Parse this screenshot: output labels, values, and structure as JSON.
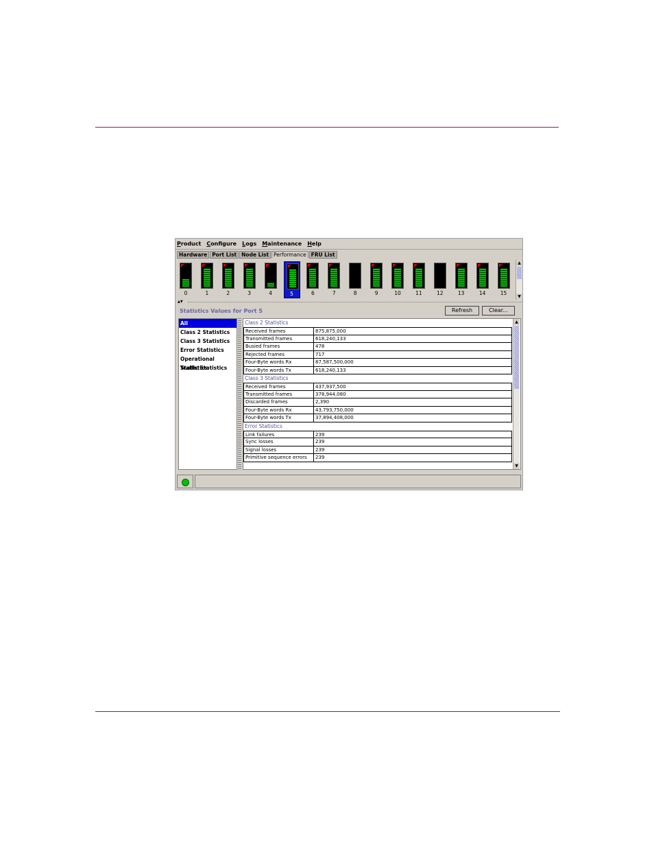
{
  "window": {
    "menus": [
      {
        "label": "Product",
        "underline": "P",
        "rest": "roduct"
      },
      {
        "label": "Configure",
        "underline": "C",
        "rest": "onfigure"
      },
      {
        "label": "Logs",
        "underline": "L",
        "rest": "ogs"
      },
      {
        "label": "Maintenance",
        "underline": "M",
        "rest": "aintenance"
      },
      {
        "label": "Help",
        "underline": "H",
        "rest": "elp"
      }
    ],
    "tabs": [
      {
        "label": "Hardware",
        "active": false
      },
      {
        "label": "Port List",
        "active": false
      },
      {
        "label": "Node List",
        "active": false
      },
      {
        "label": "Performance",
        "active": true
      },
      {
        "label": "FRU List",
        "active": false
      }
    ]
  },
  "ports": [
    {
      "num": "0",
      "level": 0.35,
      "flag": true
    },
    {
      "num": "1",
      "level": 0.85,
      "flag": true
    },
    {
      "num": "2",
      "level": 0.85,
      "flag": true
    },
    {
      "num": "3",
      "level": 0.85,
      "flag": true
    },
    {
      "num": "4",
      "level": 0.2,
      "flag": true
    },
    {
      "num": "5",
      "level": 0.85,
      "flag": true,
      "selected": true
    },
    {
      "num": "6",
      "level": 0.85,
      "flag": true
    },
    {
      "num": "7",
      "level": 0.85,
      "flag": true
    },
    {
      "num": "8",
      "level": 0,
      "flag": false
    },
    {
      "num": "9",
      "level": 0.85,
      "flag": true
    },
    {
      "num": "10",
      "level": 0.85,
      "flag": true
    },
    {
      "num": "11",
      "level": 0.85,
      "flag": true
    },
    {
      "num": "12",
      "level": 0,
      "flag": false
    },
    {
      "num": "13",
      "level": 0.85,
      "flag": true
    },
    {
      "num": "14",
      "level": 0.85,
      "flag": true
    },
    {
      "num": "15",
      "level": 0.85,
      "flag": true
    }
  ],
  "stats": {
    "title": "Statistics Values for Port 5",
    "refresh_label": "Refresh",
    "clear_label": "Clear...",
    "nav": [
      "All",
      "Class 2 Statistics",
      "Class 3 Statistics",
      "Error Statistics",
      "Operational Statistics",
      "Traffic Statistics"
    ],
    "sections": [
      {
        "title": "Class 2 Statistics",
        "rows": [
          [
            "Received frames",
            "875,875,000"
          ],
          [
            "Transmitted frames",
            "618,240,133"
          ],
          [
            "Busied frames",
            "478"
          ],
          [
            "Rejected frames",
            "717"
          ],
          [
            "Four-Byte words Rx",
            "87,587,500,000"
          ],
          [
            "Four-Byte words Tx",
            "618,240,133"
          ]
        ]
      },
      {
        "title": "Class 3 Statistics",
        "rows": [
          [
            "Received frames",
            "437,937,500"
          ],
          [
            "Transmitted frames",
            "378,944,080"
          ],
          [
            "Discarded frames",
            "2,390"
          ],
          [
            "Four-Byte words Rx",
            "43,793,750,000"
          ],
          [
            "Four-Byte words Tx",
            "37,894,408,000"
          ]
        ]
      },
      {
        "title": "Error Statistics",
        "rows": [
          [
            "Link failures",
            "239"
          ],
          [
            "Sync losses",
            "239"
          ],
          [
            "Signal losses",
            "239"
          ],
          [
            "Primitive sequence errors",
            "239"
          ]
        ]
      }
    ]
  },
  "colors": {
    "rule": "#8a1a5b",
    "selection": "#0000e0",
    "led": "#00c000"
  }
}
